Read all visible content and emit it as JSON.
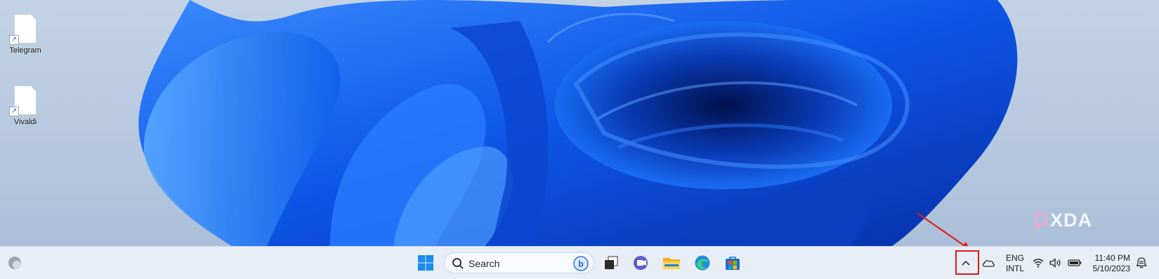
{
  "desktop": {
    "icons": [
      {
        "label": "Telegram",
        "icon": "shortcut-file-icon"
      },
      {
        "label": "Vivaldi",
        "icon": "shortcut-file-icon"
      }
    ],
    "watermark": "XDA"
  },
  "taskbar": {
    "search_placeholder": "Search",
    "pinned_apps": [
      "start-icon",
      "task-view-icon",
      "teams-meet-icon",
      "file-explorer-icon",
      "edge-icon",
      "store-icon"
    ],
    "tray": {
      "language_line1": "ENG",
      "language_line2": "INTL",
      "time": "11:40 PM",
      "date": "5/10/2023"
    }
  },
  "colors": {
    "taskbar_bg": "#e8eef6",
    "accent_blue": "#0a64e0",
    "annotation_red": "#e01919"
  }
}
